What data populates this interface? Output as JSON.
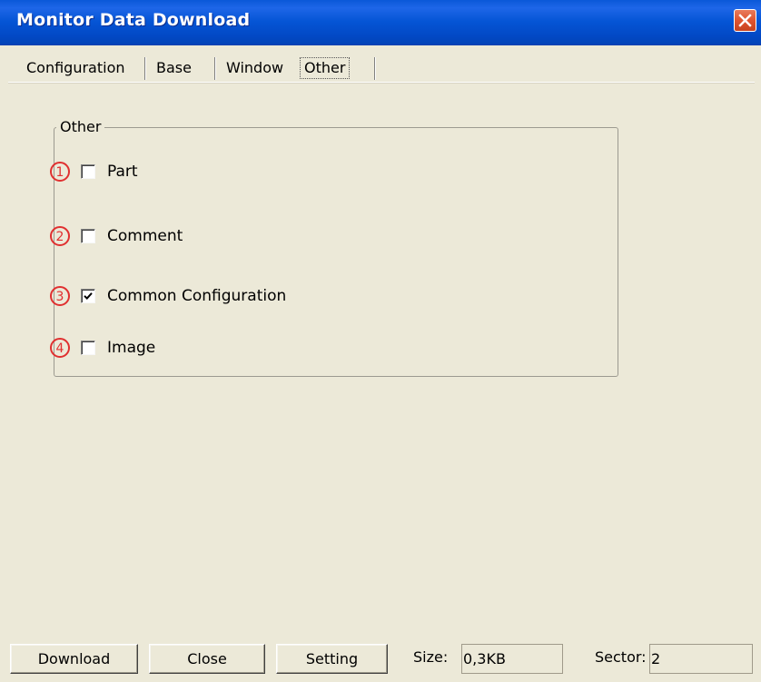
{
  "window": {
    "title": "Monitor Data Download"
  },
  "tabs": [
    {
      "label": "Configuration"
    },
    {
      "label": "Base"
    },
    {
      "label": "Window"
    },
    {
      "label": "Other"
    }
  ],
  "active_tab": "Other",
  "group": {
    "label": "Other",
    "options": [
      {
        "number": "1",
        "label": "Part",
        "checked": false
      },
      {
        "number": "2",
        "label": "Comment",
        "checked": false
      },
      {
        "number": "3",
        "label": "Common Configuration",
        "checked": true
      },
      {
        "number": "4",
        "label": "Image",
        "checked": false
      }
    ]
  },
  "buttons": {
    "download": "Download",
    "close": "Close",
    "setting": "Setting"
  },
  "status": {
    "size_label": "Size:",
    "size_value": "0,3KB",
    "sector_label": "Sector:",
    "sector_value": "2"
  },
  "colors": {
    "titlebar": "#0555d5",
    "window_bg": "#ece9d8",
    "close_button": "#e05531",
    "badge_red": "#e03030"
  },
  "icons": {
    "close": "close-x-icon",
    "badge": "circled-number-icon",
    "check": "checkmark-icon"
  }
}
